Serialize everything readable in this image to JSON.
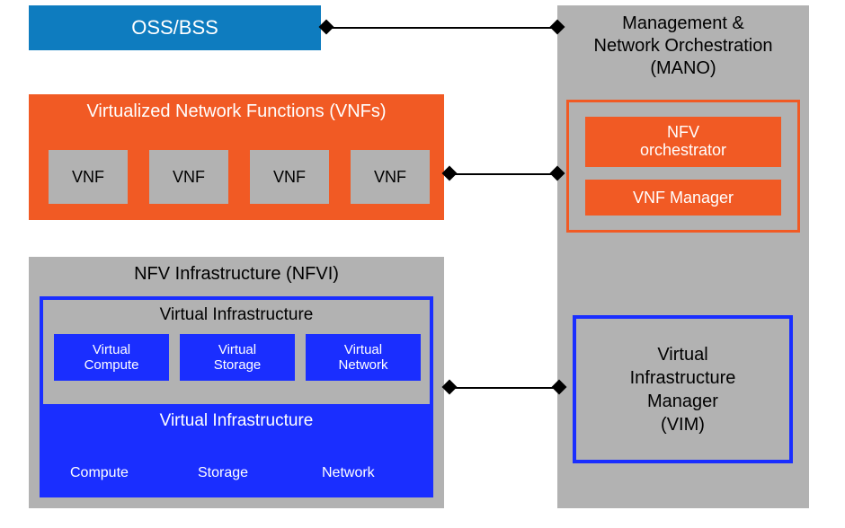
{
  "oss": {
    "title": "OSS/BSS"
  },
  "mano": {
    "title_line1": "Management &",
    "title_line2": "Network Orchestration",
    "title_line3": "(MANO)",
    "nfvo_line1": "NFV",
    "nfvo_line2": "orchestrator",
    "vnfm": "VNF Manager",
    "vim_line1": "Virtual",
    "vim_line2": "Infrastructure",
    "vim_line3": "Manager",
    "vim_line4": "(VIM)"
  },
  "vnfs": {
    "title": "Virtualized Network Functions (VNFs)",
    "items": [
      "VNF",
      "VNF",
      "VNF",
      "VNF"
    ]
  },
  "nfvi": {
    "title": "NFV Infrastructure (NFVI)",
    "virtual_title_top": "Virtual Infrastructure",
    "virtual_compute": "Virtual\nCompute",
    "virtual_storage": "Virtual\nStorage",
    "virtual_network": "Virtual\nNetwork",
    "virtual_title_bottom": "Virtual Infrastructure",
    "phys_compute": "Compute",
    "phys_storage": "Storage",
    "phys_network": "Network"
  },
  "colors": {
    "blue_fill": "#0e7cbf",
    "orange": "#f15a24",
    "grey": "#b2b2b2",
    "blue_bright": "#1a2eff"
  }
}
